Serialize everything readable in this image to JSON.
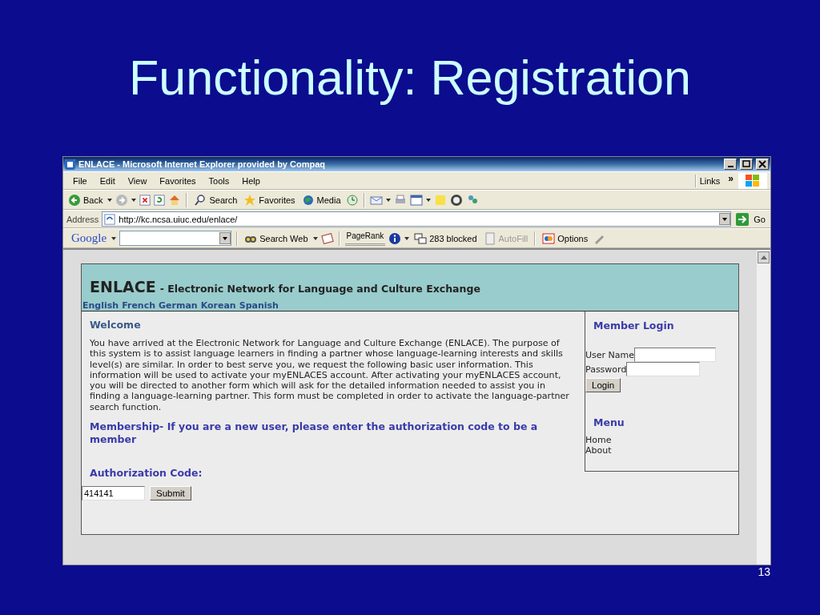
{
  "slide": {
    "title": "Functionality: Registration",
    "page_number": "13"
  },
  "browser": {
    "title": "ENLACE - Microsoft Internet Explorer provided by Compaq",
    "menu": [
      "File",
      "Edit",
      "View",
      "Favorites",
      "Tools",
      "Help"
    ],
    "links": "Links",
    "chevron": "»",
    "toolbar": {
      "back": "Back",
      "search": "Search",
      "favorites": "Favorites",
      "media": "Media"
    },
    "address": {
      "label": "Address",
      "value": "http://kc.ncsa.uiuc.edu/enlace/",
      "go": "Go"
    },
    "google_toolbar": {
      "logo": "Google",
      "search_web": "Search Web",
      "pagerank": "PageRank",
      "blocked": "283 blocked",
      "autofill": {
        "label": "AutoFill",
        "disabled": true
      },
      "options": "Options"
    }
  },
  "page": {
    "brand": "ENLACE",
    "tagline": "- Electronic Network for Language and Culture Exchange",
    "languages": [
      "English",
      "French",
      "German",
      "Korean",
      "Spanish"
    ],
    "welcome": {
      "heading": "Welcome",
      "text": "You have arrived at the Electronic Network for Language and Culture Exchange (ENLACE). The purpose of this system is to assist language learners in finding a partner whose language-learning interests and skills level(s) are similar. In order to best serve you, we request the following basic user information. This information will be used to activate your myENLACES account. After activating your myENLACES account, you will be directed to another form which will ask for the detailed information needed to assist you in finding a language-learning partner. This form must be completed in order to activate the language-partner search function."
    },
    "membership": "Membership- If you are a new user, please enter the authorization code to be a member",
    "auth": {
      "label": "Authorization Code:",
      "value": "414141",
      "button": "Submit"
    },
    "login": {
      "heading": "Member Login",
      "fields": [
        {
          "label": "User Name"
        },
        {
          "label": "Password"
        }
      ],
      "button": "Login"
    },
    "menu": {
      "heading": "Menu",
      "items": [
        "Home",
        "About"
      ]
    }
  }
}
